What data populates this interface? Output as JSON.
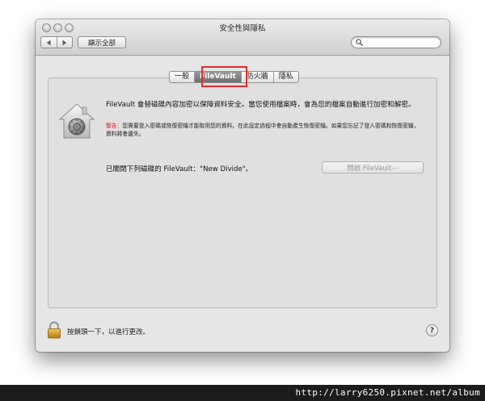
{
  "window": {
    "title": "安全性與隱私"
  },
  "toolbar": {
    "back_icon": "chevron-left-icon",
    "forward_icon": "chevron-right-icon",
    "show_all_label": "顯示全部",
    "search_placeholder": "",
    "search_icon": "search-icon"
  },
  "tabs": [
    {
      "label": "一般",
      "selected": false
    },
    {
      "label": "FileVault",
      "selected": true
    },
    {
      "label": "防火牆",
      "selected": false
    },
    {
      "label": "隱私",
      "selected": false
    }
  ],
  "filevault": {
    "icon": "filevault-house-icon",
    "heading": "FileVault 會替磁碟內容加密以保障資料安全。當您使用檔案時，會為您的檔案自動進行加密和解密。",
    "warning_label": "警告：",
    "warning_text": "您需要登入密碼或恢復密鑰才能取用您的資料。在此設定過程中會自動產生恢復密鑰。如果您忘記了登入密碼和恢復密鑰，資料將會遺失。",
    "status": "已關閉下列磁碟的 FileVault：\"New Divide\"。",
    "turn_on_button": "開啟 FileVault⋯"
  },
  "footer": {
    "lock_icon": "padlock-icon",
    "lock_text": "按鎖頭一下，以進行更改。",
    "help_label": "?"
  },
  "watermark": {
    "url": "http://larry6250.pixnet.net/album"
  },
  "colors": {
    "highlight": "#e52c2c",
    "warning": "#dd2222"
  }
}
